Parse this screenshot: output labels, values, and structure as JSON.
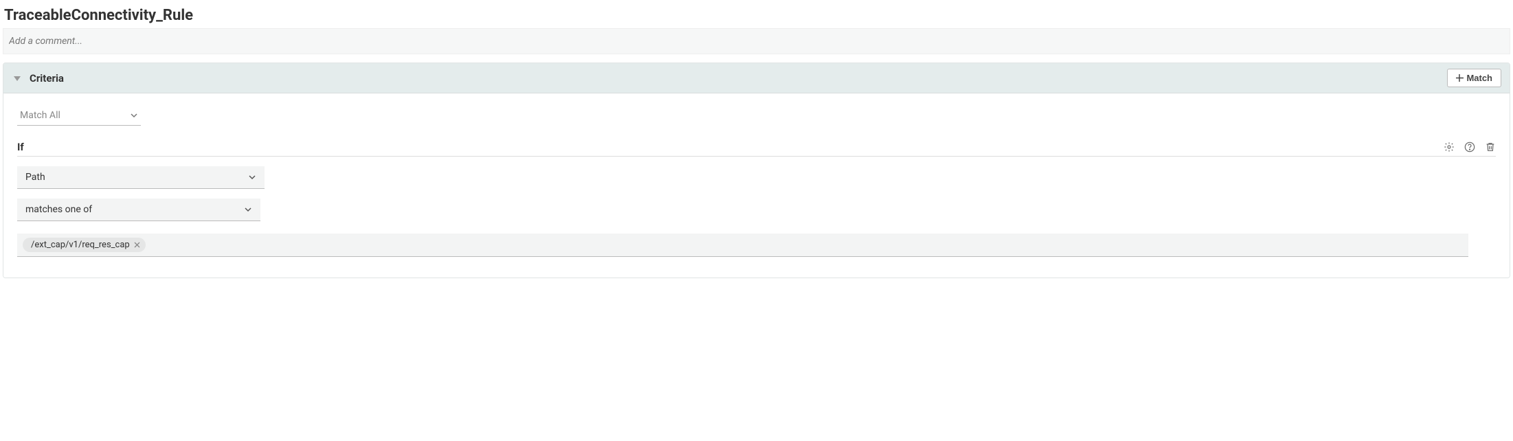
{
  "rule_title": "TraceableConnectivity_Rule",
  "comment_placeholder": "Add a comment...",
  "criteria": {
    "section_label": "Criteria",
    "add_match_label": "Match",
    "match_mode": "Match All",
    "condition": {
      "if_label": "If",
      "field": "Path",
      "operator": "matches one of",
      "value_chip": "/ext_cap/v1/req_res_cap"
    }
  }
}
